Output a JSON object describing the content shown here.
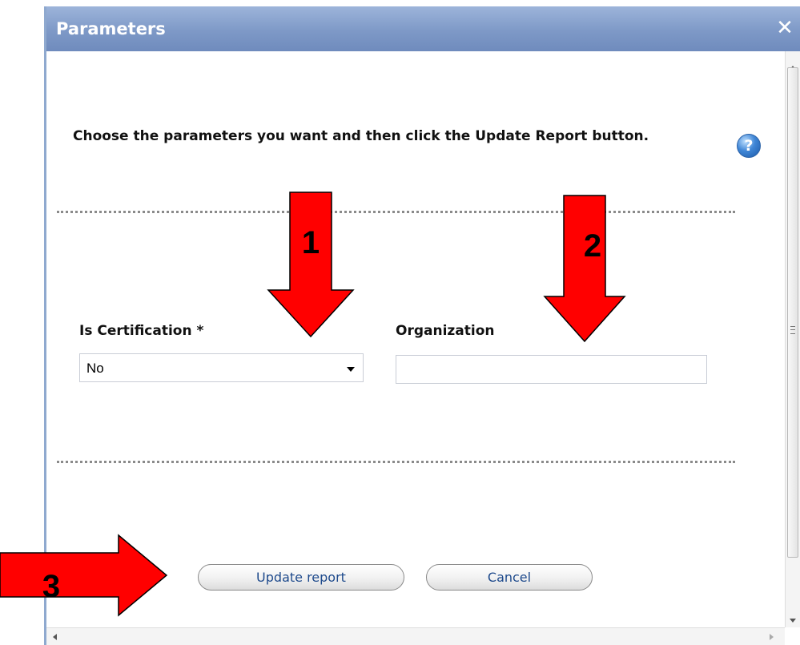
{
  "dialog": {
    "title": "Parameters",
    "close_symbol": "✕",
    "instructions": "Choose the parameters you want and then click the Update Report button.",
    "help_symbol": "?"
  },
  "fields": {
    "certification": {
      "label": "Is Certification *",
      "value": "No"
    },
    "organization": {
      "label": "Organization",
      "value": ""
    }
  },
  "buttons": {
    "update_label": "Update report",
    "cancel_label": "Cancel"
  },
  "annotations": {
    "arrow_color": "#ff0000",
    "marks": [
      "1",
      "2",
      "3"
    ]
  },
  "icons": [
    "close-icon",
    "help-icon",
    "dropdown-arrow-icon"
  ]
}
